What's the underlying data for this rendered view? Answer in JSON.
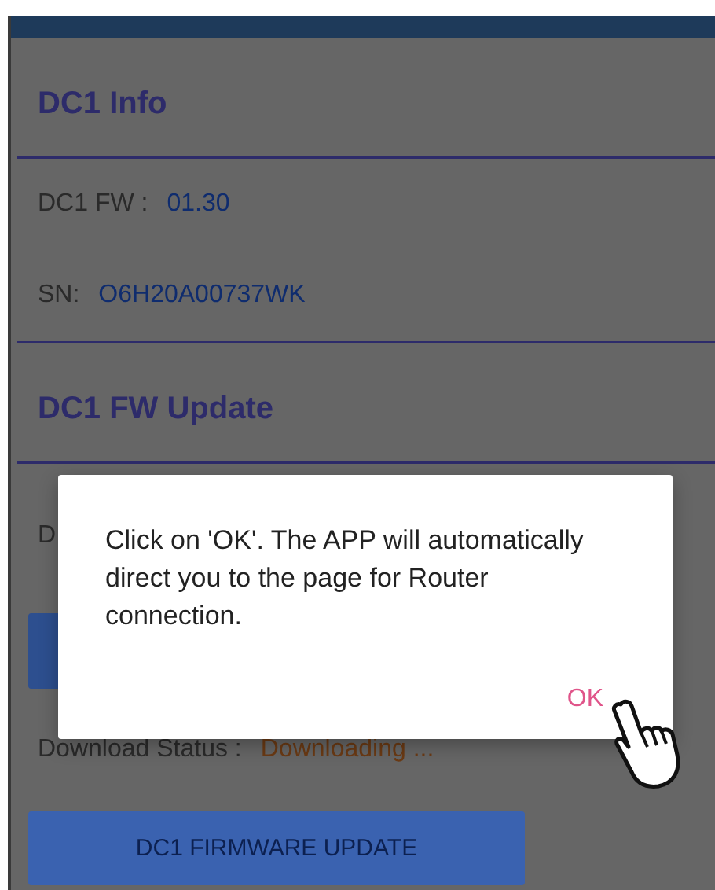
{
  "info": {
    "title": "DC1 Info",
    "fields": [
      {
        "label": "DC1 FW :",
        "value": "01.30"
      },
      {
        "label": "SN:",
        "value": "O6H20A00737WK"
      }
    ]
  },
  "update": {
    "title": "DC1 FW Update",
    "partial_label": "D",
    "download_status": {
      "label": "Download Status :",
      "value": "Downloading ..."
    },
    "button": "DC1 FIRMWARE UPDATE"
  },
  "dialog": {
    "message": "Click on 'OK'. The APP will automatically direct you to the page for Router connection.",
    "button": "OK"
  }
}
